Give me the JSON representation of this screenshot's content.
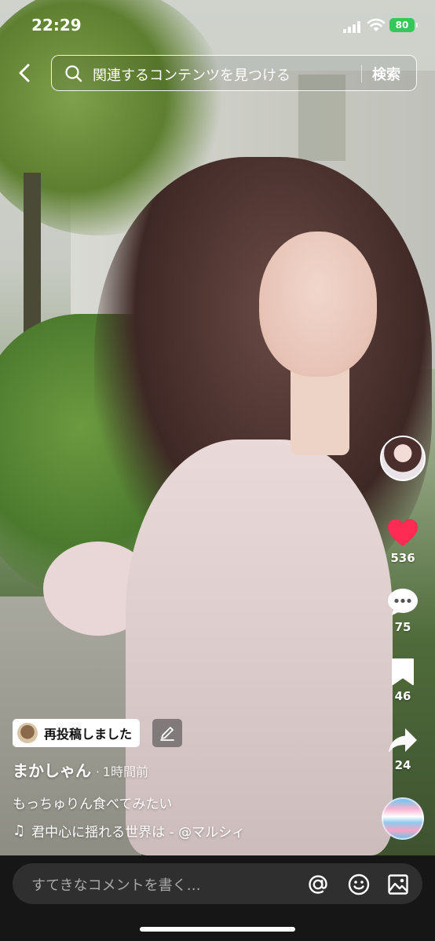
{
  "status_bar": {
    "time": "22:29",
    "battery": "80",
    "battery_color": "#34c759"
  },
  "header": {
    "back_icon": "chevron-left-icon",
    "search_placeholder": "関連するコンテンツを見つける",
    "search_button": "検索"
  },
  "actions": {
    "likes": "536",
    "comments": "75",
    "saves": "46",
    "shares": "24",
    "like_color": "#fe2c55"
  },
  "post": {
    "repost_label": "再投稿しました",
    "author": "まかしゃん",
    "separator": "·",
    "posted_ago": "1時間前",
    "caption": "もっちゅりん食べてみたい",
    "music_icon": "music-note-icon",
    "music": "君中心に揺れる世界は - @マルシィ"
  },
  "comment_bar": {
    "placeholder": "すてきなコメントを書く…",
    "icons": [
      "at-icon",
      "emoji-icon",
      "image-icon"
    ]
  }
}
